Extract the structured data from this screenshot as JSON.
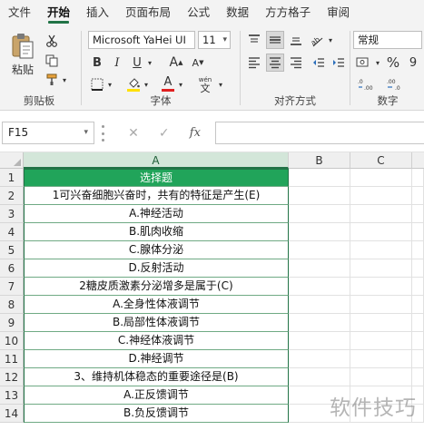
{
  "menu": {
    "tabs": [
      "文件",
      "开始",
      "插入",
      "页面布局",
      "公式",
      "数据",
      "方方格子",
      "审阅"
    ],
    "active": "开始"
  },
  "ribbon": {
    "clipboard": {
      "label": "剪贴板",
      "paste_label": "粘贴"
    },
    "font": {
      "label": "字体",
      "font_name": "Microsoft YaHei UI",
      "font_size": "11",
      "bold": "B",
      "italic": "I",
      "underline": "U",
      "increase_font": "A",
      "decrease_font": "A",
      "font_color_letter": "A",
      "phonetic": "wén",
      "font_color": "#e02020",
      "highlight_color": "#ffe000"
    },
    "alignment": {
      "label": "对齐方式"
    },
    "number": {
      "label": "数字",
      "format": "常规",
      "percent": "%",
      "comma": "9"
    }
  },
  "formula_bar": {
    "name_box": "F15",
    "cancel": "✕",
    "confirm": "✓",
    "fx": "fx"
  },
  "grid": {
    "columns": [
      "A",
      "B",
      "C"
    ],
    "selected_column": "A",
    "header_fill": "#21a45a",
    "rows": [
      {
        "n": "1",
        "a": "选择题"
      },
      {
        "n": "2",
        "a": "1可兴奋细胞兴奋时，共有的特征是产生(E)"
      },
      {
        "n": "3",
        "a": "A.神经活动"
      },
      {
        "n": "4",
        "a": "B.肌肉收缩"
      },
      {
        "n": "5",
        "a": "C.腺体分泌"
      },
      {
        "n": "6",
        "a": "D.反射活动"
      },
      {
        "n": "7",
        "a": "2糖皮质激素分泌增多是属于(C)"
      },
      {
        "n": "8",
        "a": "A.全身性体液调节"
      },
      {
        "n": "9",
        "a": "B.局部性体液调节"
      },
      {
        "n": "10",
        "a": "C.神经体液调节"
      },
      {
        "n": "11",
        "a": "D.神经调节"
      },
      {
        "n": "12",
        "a": "3、维持机体稳态的重要途径是(B)"
      },
      {
        "n": "13",
        "a": "A.正反馈调节"
      },
      {
        "n": "14",
        "a": "B.负反馈调节"
      }
    ]
  },
  "watermark": "软件技巧"
}
